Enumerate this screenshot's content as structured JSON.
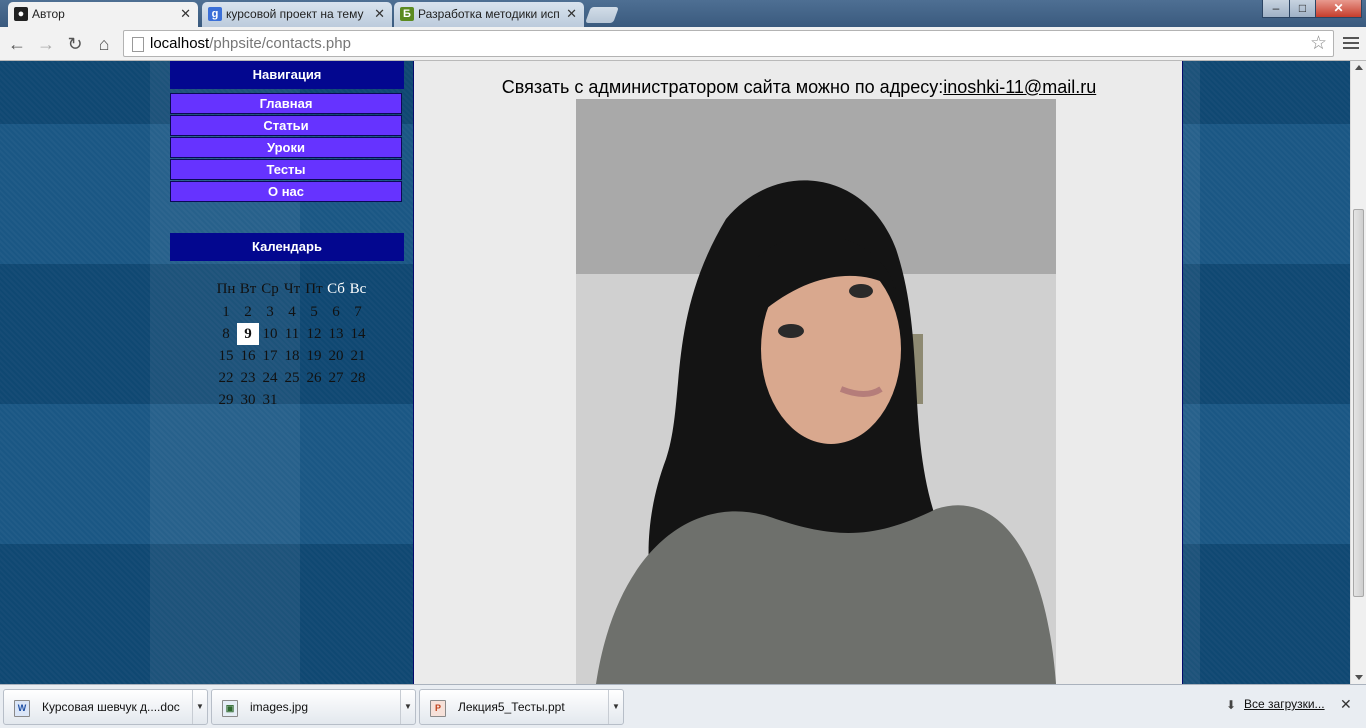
{
  "browser": {
    "tabs": [
      {
        "title": "Автор",
        "active": true,
        "icon": "incognito-icon"
      },
      {
        "title": "курсовой проект на тему",
        "active": false,
        "icon": "google-icon"
      },
      {
        "title": "Разработка методики исп",
        "active": false,
        "icon": "site-b-icon"
      }
    ],
    "url_host": "localhost",
    "url_path": "/phpsite/contacts.php",
    "window_buttons": {
      "minimize": "‒",
      "maximize": "□",
      "close": "✕"
    }
  },
  "sidebar": {
    "nav_title": "Навигация",
    "nav_items": [
      "Главная",
      "Статьи",
      "Уроки",
      "Тесты",
      "О нас"
    ],
    "calendar_title": "Календарь",
    "calendar": {
      "weekdays": [
        "Пн",
        "Вт",
        "Ср",
        "Чт",
        "Пт",
        "Сб",
        "Вс"
      ],
      "weeks": [
        [
          "1",
          "2",
          "3",
          "4",
          "5",
          "6",
          "7"
        ],
        [
          "8",
          "9",
          "10",
          "11",
          "12",
          "13",
          "14"
        ],
        [
          "15",
          "16",
          "17",
          "18",
          "19",
          "20",
          "21"
        ],
        [
          "22",
          "23",
          "24",
          "25",
          "26",
          "27",
          "28"
        ],
        [
          "29",
          "30",
          "31",
          "",
          "",
          "",
          ""
        ]
      ],
      "today": "9"
    }
  },
  "main": {
    "contact_text": "Связать с администратором сайта можно по адресу:",
    "contact_email": "inoshki-11@mail.ru"
  },
  "downloads": {
    "items": [
      {
        "name": "Курсовая шевчук д....doc",
        "icon": "word-doc-icon"
      },
      {
        "name": "images.jpg",
        "icon": "image-file-icon"
      },
      {
        "name": "Лекция5_Тесты.ppt",
        "icon": "powerpoint-file-icon"
      }
    ],
    "all_label": "Все загрузки...",
    "close": "✕"
  },
  "colors": {
    "nav_head": "#03078f",
    "nav_item": "#6633ff",
    "content_bg": "#ebebeb",
    "page_bg": "#11507f"
  }
}
